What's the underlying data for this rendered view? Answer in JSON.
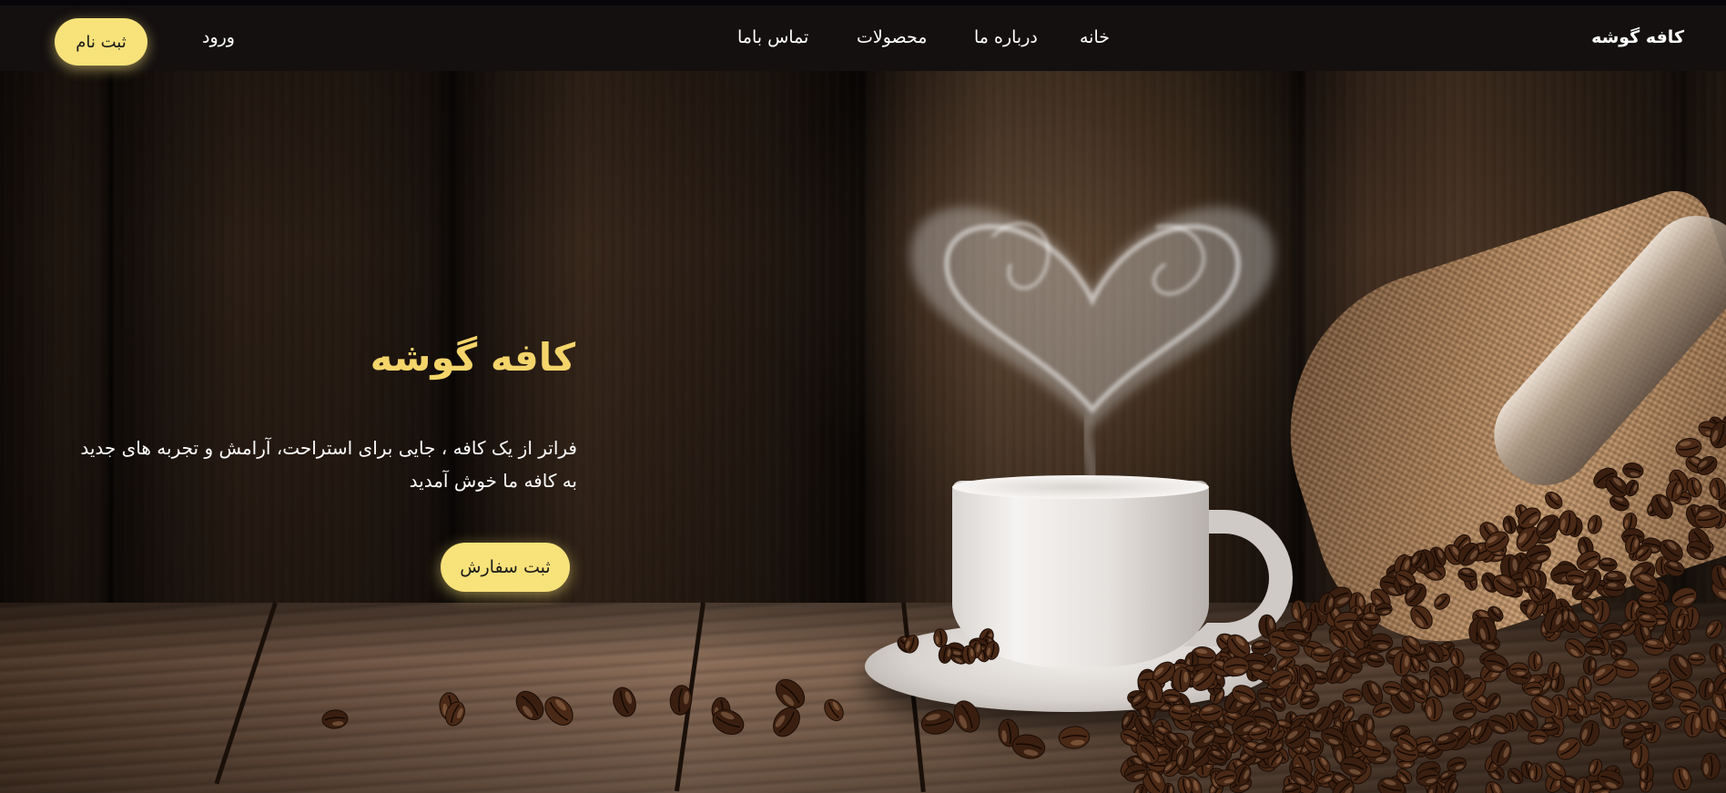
{
  "navbar": {
    "brand": "کافه گوشه",
    "links": [
      {
        "label": "خانه"
      },
      {
        "label": "درباره ما"
      },
      {
        "label": "محصولات"
      },
      {
        "label": "تماس باما"
      }
    ],
    "login_label": "ورود",
    "signup_label": "ثبت نام"
  },
  "hero": {
    "title": "کافه گوشه",
    "line1": "فراتر از یک کافه ، جایی برای استراحت، آرامش و تجربه های جدید",
    "line2": "به کافه ما خوش آمدید",
    "order_label": "ثبت سفارش"
  },
  "colors": {
    "accent": "#f8e27a",
    "title": "#f4d56b",
    "navbar_bg": "#141010"
  },
  "icons": [
    "coffee-cup-image",
    "heart-steam",
    "coffee-beans",
    "burlap-sack"
  ]
}
